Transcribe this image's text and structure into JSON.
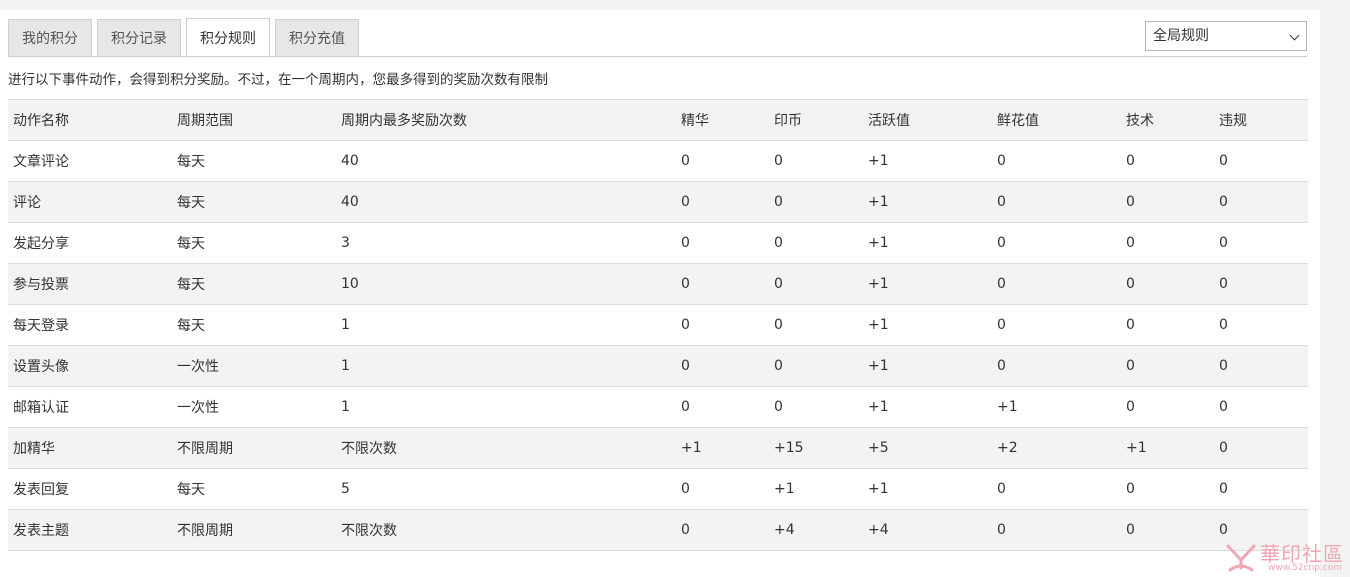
{
  "tabs": [
    {
      "label": "我的积分",
      "active": false
    },
    {
      "label": "积分记录",
      "active": false
    },
    {
      "label": "积分规则",
      "active": true
    },
    {
      "label": "积分充值",
      "active": false
    }
  ],
  "scope_select": {
    "selected": "全局规则"
  },
  "notice": "进行以下事件动作，会得到积分奖励。不过，在一个周期内，您最多得到的奖励次数有限制",
  "table": {
    "headers": [
      "动作名称",
      "周期范围",
      "周期内最多奖励次数",
      "精华",
      "印币",
      "活跃值",
      "鲜花值",
      "技术",
      "违规"
    ],
    "rows": [
      [
        "文章评论",
        "每天",
        "40",
        "0",
        "0",
        "+1",
        "0",
        "0",
        "0"
      ],
      [
        "评论",
        "每天",
        "40",
        "0",
        "0",
        "+1",
        "0",
        "0",
        "0"
      ],
      [
        "发起分享",
        "每天",
        "3",
        "0",
        "0",
        "+1",
        "0",
        "0",
        "0"
      ],
      [
        "参与投票",
        "每天",
        "10",
        "0",
        "0",
        "+1",
        "0",
        "0",
        "0"
      ],
      [
        "每天登录",
        "每天",
        "1",
        "0",
        "0",
        "+1",
        "0",
        "0",
        "0"
      ],
      [
        "设置头像",
        "一次性",
        "1",
        "0",
        "0",
        "+1",
        "0",
        "0",
        "0"
      ],
      [
        "邮箱认证",
        "一次性",
        "1",
        "0",
        "0",
        "+1",
        "+1",
        "0",
        "0"
      ],
      [
        "加精华",
        "不限周期",
        "不限次数",
        "+1",
        "+15",
        "+5",
        "+2",
        "+1",
        "0"
      ],
      [
        "发表回复",
        "每天",
        "5",
        "0",
        "+1",
        "+1",
        "0",
        "0",
        "0"
      ],
      [
        "发表主题",
        "不限周期",
        "不限次数",
        "0",
        "+4",
        "+4",
        "0",
        "0",
        "0"
      ]
    ]
  },
  "watermark": {
    "text": "華印社區",
    "url": "www.52cnp.com"
  },
  "colors": {
    "watermark": "#f2a6b3",
    "row_alt": "#f3f3f3",
    "header_bg": "#f2f2f2"
  }
}
